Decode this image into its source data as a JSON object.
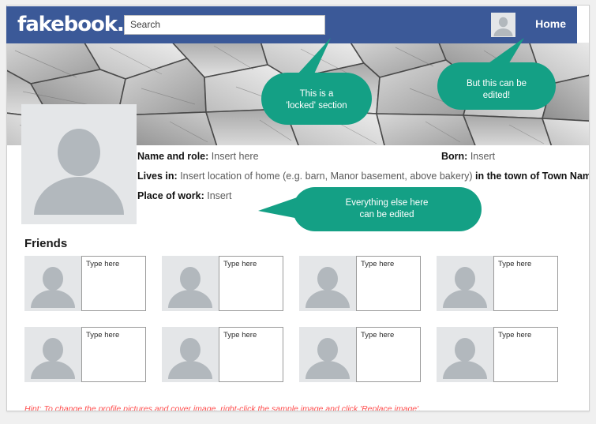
{
  "colors": {
    "header_blue": "#3b5998",
    "callout_green": "#14a085",
    "avatar_bg": "#e4e6e8",
    "avatar_fg": "#b2b8bd",
    "hint_red": "#ff4d4d",
    "page_bg": "#f0f0f0"
  },
  "header": {
    "brand": "fakebook",
    "brand_dot": ".",
    "search_value": "Search",
    "search_placeholder": "Search",
    "home_label": "Home",
    "avatar_icon": "user-avatar-icon"
  },
  "cover": {
    "icon": "cover-photo-stone-texture"
  },
  "profile": {
    "picture_icon": "user-avatar-icon",
    "rows": [
      {
        "label": "Name and role:",
        "value": "Insert here"
      },
      {
        "label": "Lives in:",
        "value": "Insert location of home (e.g. barn, Manor basement, above bakery)",
        "tail": "in the town of Town Name"
      },
      {
        "label": "Place of work:",
        "value": "Insert"
      }
    ],
    "born": {
      "label": "Born:",
      "value": "Insert"
    }
  },
  "friends": {
    "title": "Friends",
    "items": [
      {
        "name_placeholder": "Type here",
        "avatar_icon": "user-avatar-icon"
      },
      {
        "name_placeholder": "Type here",
        "avatar_icon": "user-avatar-icon"
      },
      {
        "name_placeholder": "Type here",
        "avatar_icon": "user-avatar-icon"
      },
      {
        "name_placeholder": "Type here",
        "avatar_icon": "user-avatar-icon"
      },
      {
        "name_placeholder": "Type here",
        "avatar_icon": "user-avatar-icon"
      },
      {
        "name_placeholder": "Type here",
        "avatar_icon": "user-avatar-icon"
      },
      {
        "name_placeholder": "Type here",
        "avatar_icon": "user-avatar-icon"
      },
      {
        "name_placeholder": "Type here",
        "avatar_icon": "user-avatar-icon"
      }
    ]
  },
  "callouts": {
    "locked": {
      "line1": "This is a",
      "line2": "'locked' section"
    },
    "edited": {
      "line1": "But this can be",
      "line2": "edited!"
    },
    "everything_else": {
      "line1": "Everything else here",
      "line2": "can be edited"
    }
  },
  "hint": {
    "prefix": "Hint:",
    "text": " To change the profile pictures and cover image, right-click the sample image and click 'Replace image'."
  }
}
